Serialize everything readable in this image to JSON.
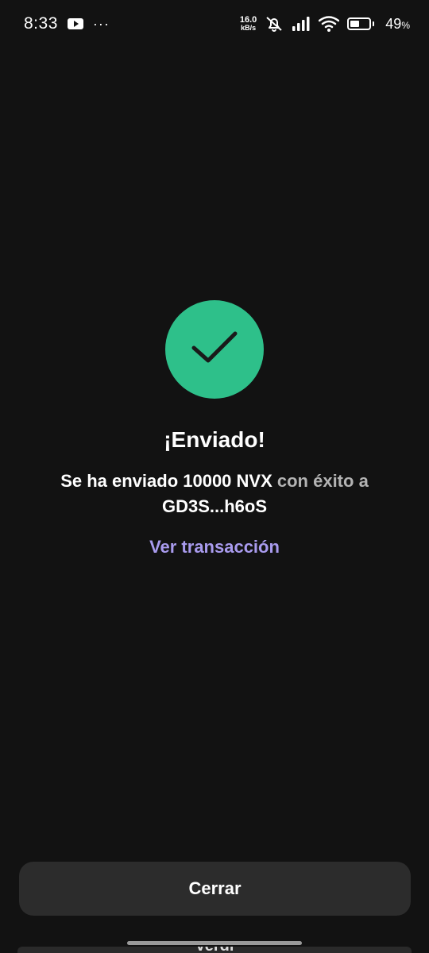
{
  "status_bar": {
    "time": "8:33",
    "left_icons": [
      "youtube-icon",
      "more-dots-icon"
    ],
    "more_dots": "···",
    "net_speed_value": "16.0",
    "net_speed_unit": "kB/s",
    "right_icons": [
      "mute-bell-icon",
      "signal-icon",
      "wifi-icon",
      "battery-icon"
    ],
    "battery_level": 0.49,
    "battery_number": "49",
    "battery_suffix": "%"
  },
  "result": {
    "icon": "check-icon",
    "icon_color": "#2ec08a",
    "title": "¡Enviado!",
    "message_part1": "Se ha enviado 10000 NVX",
    "message_part2": " con éxito a ",
    "message_part3": "GD3S...h6oS",
    "link_label": "Ver transacción",
    "link_color": "#a99bee"
  },
  "footer": {
    "close_label": "Cerrar",
    "peek_text": "Verdi"
  }
}
